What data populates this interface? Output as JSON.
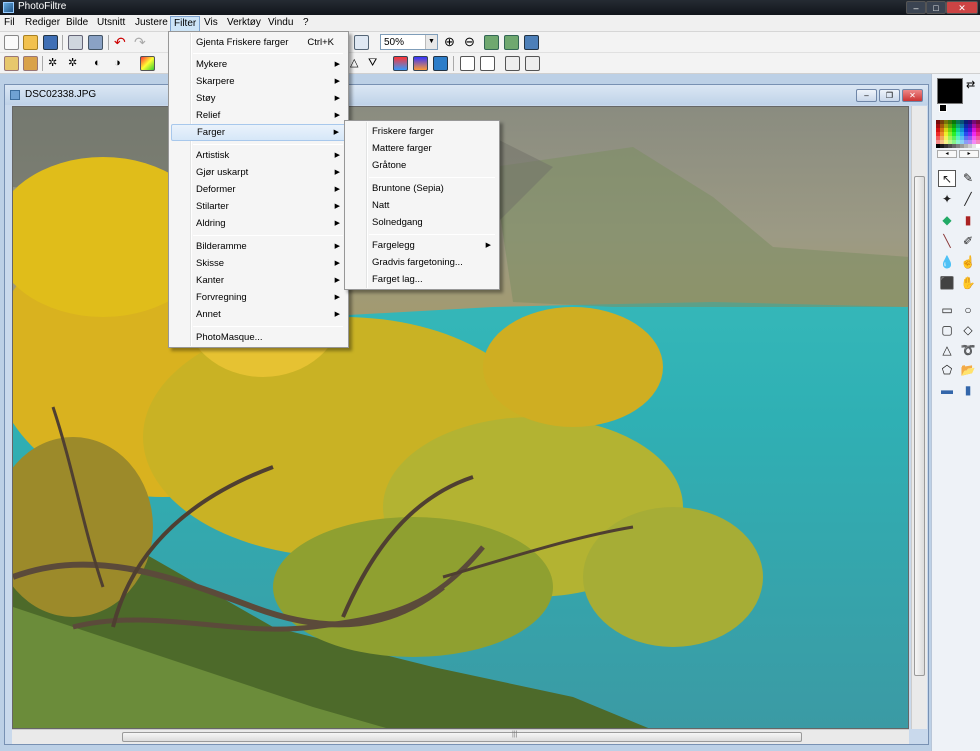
{
  "app": {
    "title": "PhotoFiltre"
  },
  "menubar": [
    "Fil",
    "Rediger",
    "Bilde",
    "Utsnitt",
    "Justere",
    "Filter",
    "Vis",
    "Verktøy",
    "Vindu",
    "?"
  ],
  "zoom": {
    "value": "50%"
  },
  "document": {
    "title": "DSC02338.JPG"
  },
  "filter_menu": {
    "repeat": {
      "label": "Gjenta Friskere farger",
      "shortcut": "Ctrl+K"
    },
    "group1": [
      "Mykere",
      "Skarpere",
      "Støy",
      "Relief",
      "Farger"
    ],
    "group2": [
      "Artistisk",
      "Gjør uskarpt",
      "Deformer",
      "Stilarter",
      "Aldring"
    ],
    "group3": [
      "Bilderamme",
      "Skisse",
      "Kanter",
      "Forvregning",
      "Annet"
    ],
    "photomasque": "PhotoMasque..."
  },
  "farger_menu": {
    "group1": [
      "Friskere farger",
      "Mattere farger",
      "Gråtone"
    ],
    "group2": [
      "Bruntone (Sepia)",
      "Natt",
      "Solnedgang"
    ],
    "group3": [
      "Fargelegg",
      "Gradvis fargetoning...",
      "Farget lag..."
    ]
  },
  "colors": {
    "foreground": "#000000",
    "background": "#000000",
    "menu_highlight": "#d6e7f8"
  }
}
